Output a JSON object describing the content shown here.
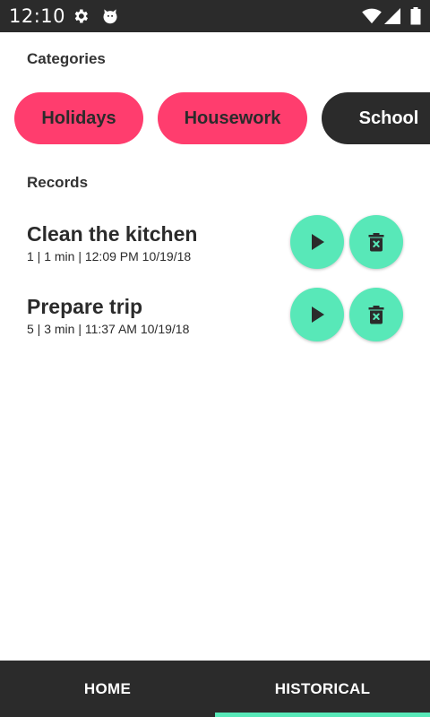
{
  "status_bar": {
    "time": "12:10",
    "icons": [
      "gear-icon",
      "cat-notification-icon",
      "wifi-icon",
      "signal-icon",
      "battery-icon"
    ]
  },
  "colors": {
    "accent": "#58e8b8",
    "chip_pink": "#ff3d6e",
    "dark": "#2b2b2b"
  },
  "categories": {
    "title": "Categories",
    "chips": [
      {
        "label": "Holidays",
        "style": "pink"
      },
      {
        "label": "Housework",
        "style": "pink"
      },
      {
        "label": "School",
        "style": "dark"
      }
    ]
  },
  "records": {
    "title": "Records",
    "items": [
      {
        "title": "Clean the kitchen",
        "meta": "1 | 1 min | 12:09 PM 10/19/18"
      },
      {
        "title": "Prepare trip",
        "meta": "5 | 3 min | 11:37 AM 10/19/18"
      }
    ]
  },
  "nav": {
    "tabs": [
      {
        "label": "HOME"
      },
      {
        "label": "HISTORICAL",
        "selected": true
      }
    ]
  }
}
